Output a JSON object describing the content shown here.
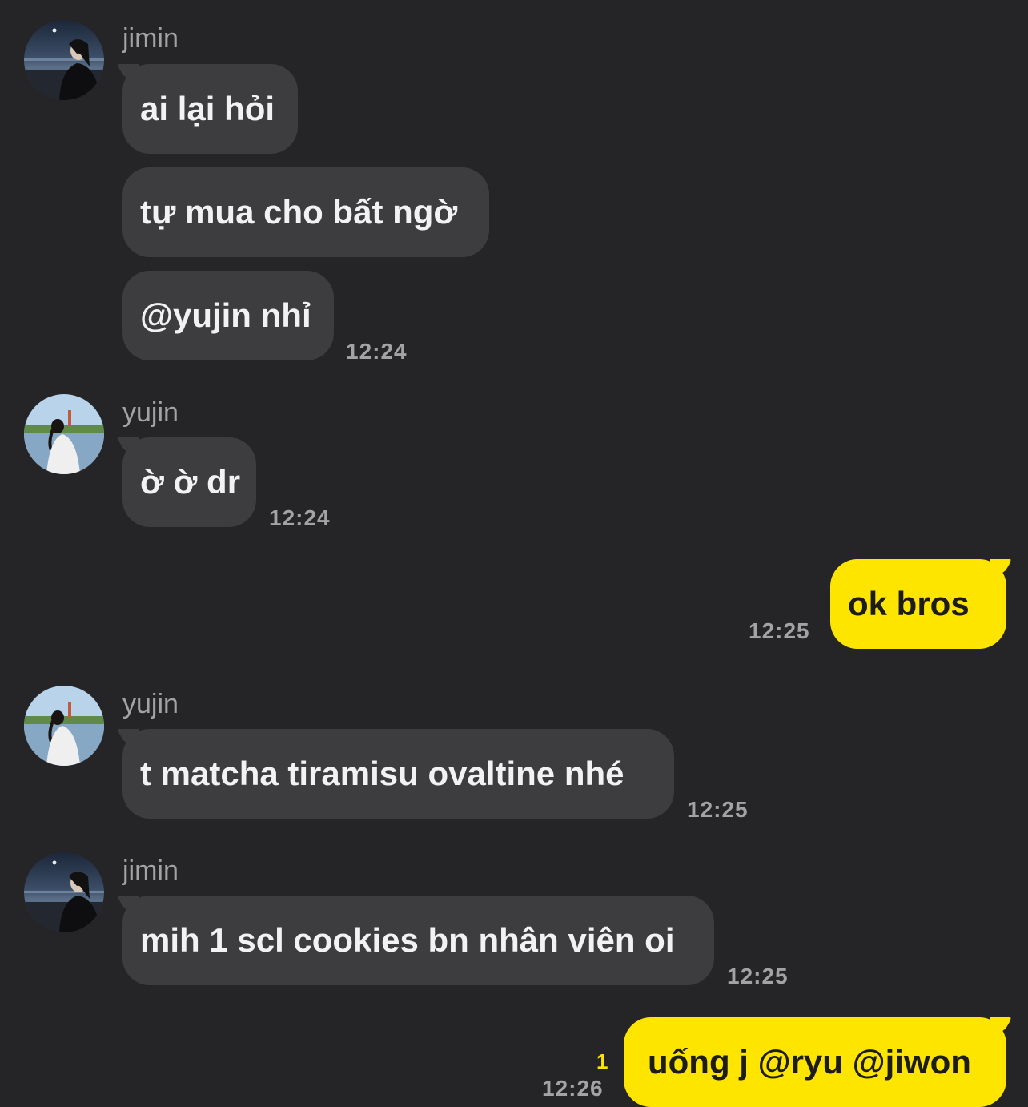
{
  "colors": {
    "background": "#252527",
    "incoming_bubble": "#3d3d3f",
    "outgoing_bubble": "#fee500",
    "meta_text": "#a3a3a6",
    "unread_count": "#fee500"
  },
  "messages": {
    "g1": {
      "sender": "jimin",
      "avatar": "jimin-avatar-photo",
      "m1": "ai lại hỏi",
      "m2": "tự mua cho bất ngờ",
      "m3": "@yujin nhỉ",
      "time": "12:24"
    },
    "g2": {
      "sender": "yujin",
      "avatar": "yujin-avatar-photo",
      "m1": "ờ ờ dr",
      "time": "12:24"
    },
    "g3": {
      "sender": "me",
      "m1": "ok bros",
      "time": "12:25"
    },
    "g4": {
      "sender": "yujin",
      "avatar": "yujin-avatar-photo",
      "m1": "t matcha tiramisu ovaltine nhé",
      "time": "12:25"
    },
    "g5": {
      "sender": "jimin",
      "avatar": "jimin-avatar-photo",
      "m1": "mih 1 scl cookies bn nhân viên oi",
      "time": "12:25"
    },
    "g6": {
      "sender": "me",
      "m1": "uống j @ryu @jiwon",
      "time": "12:26",
      "unread": "1"
    }
  }
}
